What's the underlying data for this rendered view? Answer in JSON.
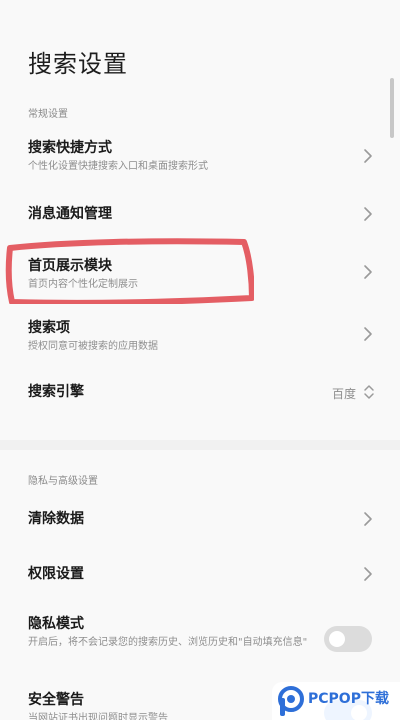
{
  "page": {
    "title": "搜索设置"
  },
  "sections": {
    "general": "常规设置",
    "privacy": "隐私与高级设置"
  },
  "rows": {
    "shortcut": {
      "title": "搜索快捷方式",
      "subtitle": "个性化设置快捷搜索入口和桌面搜索形式"
    },
    "notifications": {
      "title": "消息通知管理"
    },
    "homepage_modules": {
      "title": "首页展示模块",
      "subtitle": "首页内容个性化定制展示"
    },
    "search_items": {
      "title": "搜索项",
      "subtitle": "授权同意可被搜索的应用数据"
    },
    "search_engine": {
      "title": "搜索引擎",
      "value": "百度"
    },
    "clear_data": {
      "title": "清除数据"
    },
    "permissions": {
      "title": "权限设置"
    },
    "private_mode": {
      "title": "隐私模式",
      "subtitle": "开启后，将不会记录您的搜索历史、浏览历史和\"自动填充信息\"",
      "enabled": false
    },
    "security_warning": {
      "title": "安全警告",
      "subtitle": "当网站证书出现问题时显示警告",
      "enabled": true
    }
  },
  "watermark": {
    "text": "PCPOP下载"
  },
  "colors": {
    "accent": "#2b7df6",
    "highlight_stroke": "#e0434a",
    "toggle_off": "#dcdcdc",
    "watermark": "#2e6fd8"
  }
}
